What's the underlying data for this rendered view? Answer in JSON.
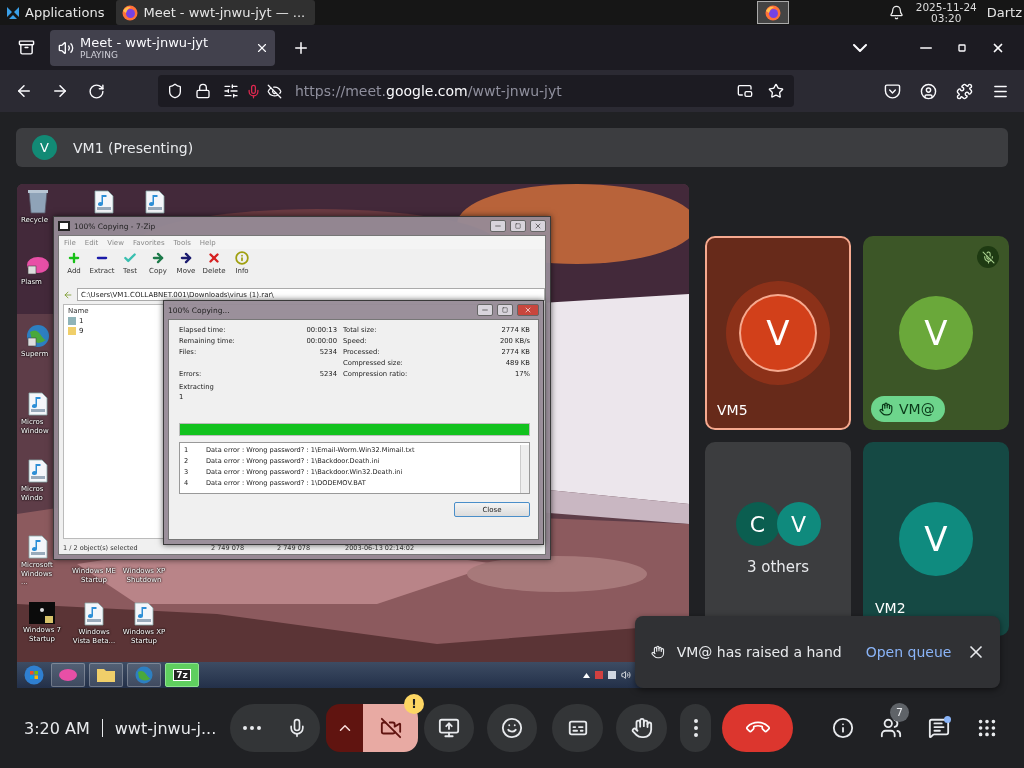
{
  "os_panel": {
    "menu_label": "Applications",
    "tasks": [
      {
        "title": "Meet - wwt-jnwu-jyt — ...",
        "selected": true
      }
    ],
    "date": "2025-11-24",
    "time": "03:20",
    "user": "Dartz"
  },
  "browser": {
    "tabs": [
      {
        "title": "Meet - wwt-jnwu-jyt",
        "status": "PLAYING",
        "selected": true
      }
    ],
    "url": "https://meet.**google.com**/wwt-jnwu-jyt",
    "mic_in_use": true
  },
  "meet": {
    "presenter": {
      "initial": "V",
      "label": "VM1 (Presenting)"
    },
    "shared_screen": {
      "desktop_icons": [
        {
          "label": "Recycle",
          "kind": "recycle"
        },
        {
          "kind": "file"
        },
        {
          "kind": "file"
        },
        {
          "label": "Plasm",
          "kind": "plasma"
        },
        {
          "label": "Superm",
          "kind": "globe"
        },
        {
          "label": "Micros Window",
          "kind": "file"
        },
        {
          "label": "Micros Windo",
          "kind": "file"
        },
        {
          "label": "Microsoft Windows ...",
          "kind": "file"
        },
        {
          "label": "Windows ME Startup",
          "kind": "covered"
        },
        {
          "label": "Windows XP Shutdown",
          "kind": "covered"
        },
        {
          "label": "Windows 7 Startup",
          "kind": "shortcut"
        },
        {
          "label": "Windows Vista Beta...",
          "kind": "file"
        },
        {
          "label": "Windows XP Startup",
          "kind": "file"
        }
      ],
      "archive_window": {
        "title": "100% Copying - 7-Zip",
        "menu": [
          "File",
          "Edit",
          "View",
          "Favorites",
          "Tools",
          "Help"
        ],
        "tools": [
          {
            "label": "Add",
            "kind": "add"
          },
          {
            "label": "Extract",
            "kind": "extract"
          },
          {
            "label": "Test",
            "kind": "test"
          },
          {
            "label": "Copy",
            "kind": "copy"
          },
          {
            "label": "Move",
            "kind": "move"
          },
          {
            "label": "Delete",
            "kind": "delete"
          },
          {
            "label": "Info",
            "kind": "info"
          }
        ],
        "path": "C:\\Users\\VM1.COLLABNET.001\\Downloads\\virus (1).rar\\",
        "column": "Name",
        "items": [
          {
            "name": "1",
            "kind": "archive"
          },
          {
            "name": "9",
            "kind": "folder"
          }
        ],
        "status": [
          "1 / 2 object(s) selected",
          "2 749 078",
          "2 749 078",
          "2003-06-13 02:14:02"
        ]
      },
      "progress_dialog": {
        "title": "100% Copying...",
        "left_stats": [
          {
            "label": "Elapsed time:",
            "value": "00:00:13"
          },
          {
            "label": "Remaining time:",
            "value": "00:00:00"
          },
          {
            "label": "Files:",
            "value": "5234"
          },
          {
            "label": "Errors:",
            "value": "5234"
          }
        ],
        "right_stats": [
          {
            "label": "Total size:",
            "value": "2774 KB"
          },
          {
            "label": "Speed:",
            "value": "200 KB/s"
          },
          {
            "label": "Processed:",
            "value": "2774 KB"
          },
          {
            "label": "Compressed size:",
            "value": "489 KB"
          },
          {
            "label": "Compression ratio:",
            "value": "17%"
          }
        ],
        "action": "Extracting",
        "current": "1",
        "level": 1,
        "log": [
          {
            "n": "1",
            "text": "Data error : Wrong password? : 1\\Email-Worm.Win32.Mimail.txt"
          },
          {
            "n": "2",
            "text": "Data error : Wrong password? : 1\\Backdoor.Death.ini"
          },
          {
            "n": "3",
            "text": "Data error : Wrong password? : 1\\Backdoor.Win32.Death.ini"
          },
          {
            "n": "4",
            "text": "Data error : Wrong password? : 1\\DODEMOV.BAT"
          }
        ],
        "close": "Close"
      },
      "taskbar": [
        {
          "kind": "start",
          "selected": false
        },
        {
          "kind": "plasma",
          "selected": false
        },
        {
          "kind": "folder",
          "selected": false
        },
        {
          "kind": "globe",
          "selected": false
        },
        {
          "kind": "archiver",
          "label": "7z",
          "selected": true
        }
      ]
    },
    "tiles": [
      {
        "kind": "person",
        "name": "VM5",
        "initial": "V",
        "color": "#d2401a",
        "speaking": true,
        "muted": false,
        "hand_raised": false
      },
      {
        "kind": "person",
        "name": "VM@",
        "initial": "V",
        "color": "#6aa83a",
        "speaking": false,
        "muted": true,
        "hand_raised": true
      },
      {
        "kind": "others",
        "label": "3 others",
        "avatars": [
          {
            "initial": "C",
            "color": "#0b5e50"
          },
          {
            "initial": "V",
            "color": "#0f8a7d"
          }
        ]
      },
      {
        "kind": "person",
        "name": "VM2",
        "initial": "V",
        "color": "#0f8b7f",
        "speaking": false,
        "muted": false,
        "hand_raised": false
      }
    ],
    "toast": {
      "message": "VM@ has raised a hand",
      "action": "Open queue"
    },
    "time": "3:20 AM",
    "meeting_code": "wwt-jnwu-j...",
    "controls": [
      {
        "kind": "more"
      },
      {
        "kind": "mic",
        "on": true
      },
      {
        "kind": "camera_menu"
      },
      {
        "kind": "camera",
        "on": false,
        "alert": "!"
      },
      {
        "kind": "present"
      },
      {
        "kind": "reactions"
      },
      {
        "kind": "captions",
        "on": false
      },
      {
        "kind": "hand",
        "on": false
      },
      {
        "kind": "options"
      },
      {
        "kind": "leave"
      }
    ],
    "people_count": "7",
    "chat_unread": true
  }
}
